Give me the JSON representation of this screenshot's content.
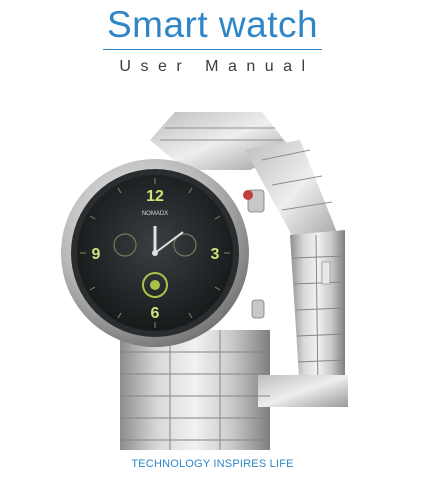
{
  "document": {
    "title": "Smart watch",
    "subtitle": "User Manual",
    "tagline": "TECHNOLOGY INSPIRES LIFE",
    "accent_color": "#2f86c6"
  },
  "watch_face": {
    "brand": "NOMADX",
    "hour_numerals": [
      "12",
      "3",
      "6",
      "9"
    ]
  }
}
